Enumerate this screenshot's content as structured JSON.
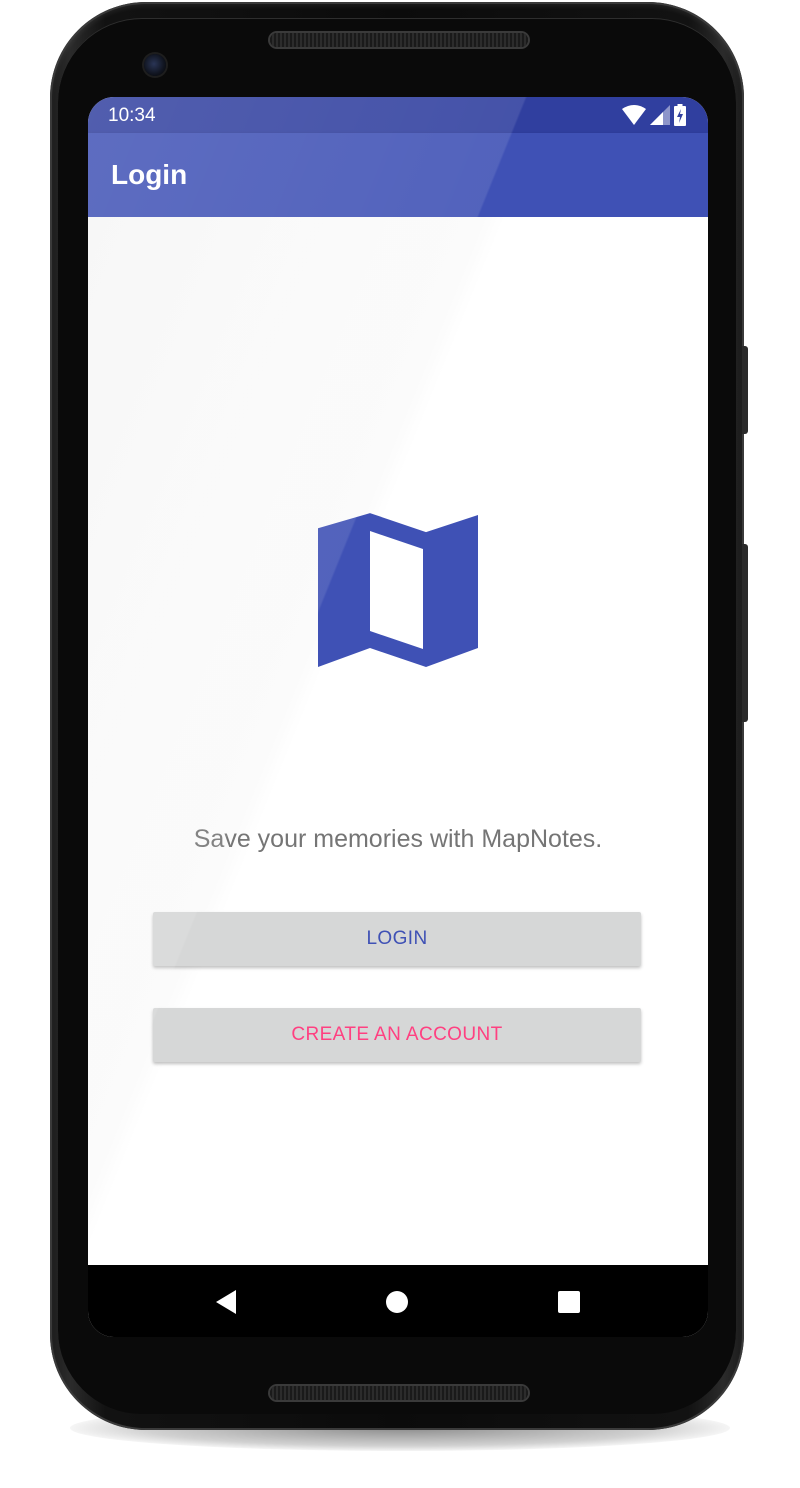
{
  "status_bar": {
    "time": "10:34",
    "icons": [
      "wifi-icon",
      "signal-icon",
      "battery-charging-icon"
    ],
    "color": "#303f9f"
  },
  "app_bar": {
    "title": "Login",
    "color": "#3f51b5"
  },
  "main": {
    "logo_icon": "map-icon",
    "logo_color": "#3f51b5",
    "tagline": "Save your memories with MapNotes.",
    "login_button": {
      "label": "LOGIN",
      "color": "#3f51b5"
    },
    "create_account_button": {
      "label": "CREATE AN ACCOUNT",
      "color": "#ff4081"
    }
  },
  "nav_bar": {
    "buttons": [
      "back-icon",
      "home-icon",
      "recents-icon"
    ]
  }
}
